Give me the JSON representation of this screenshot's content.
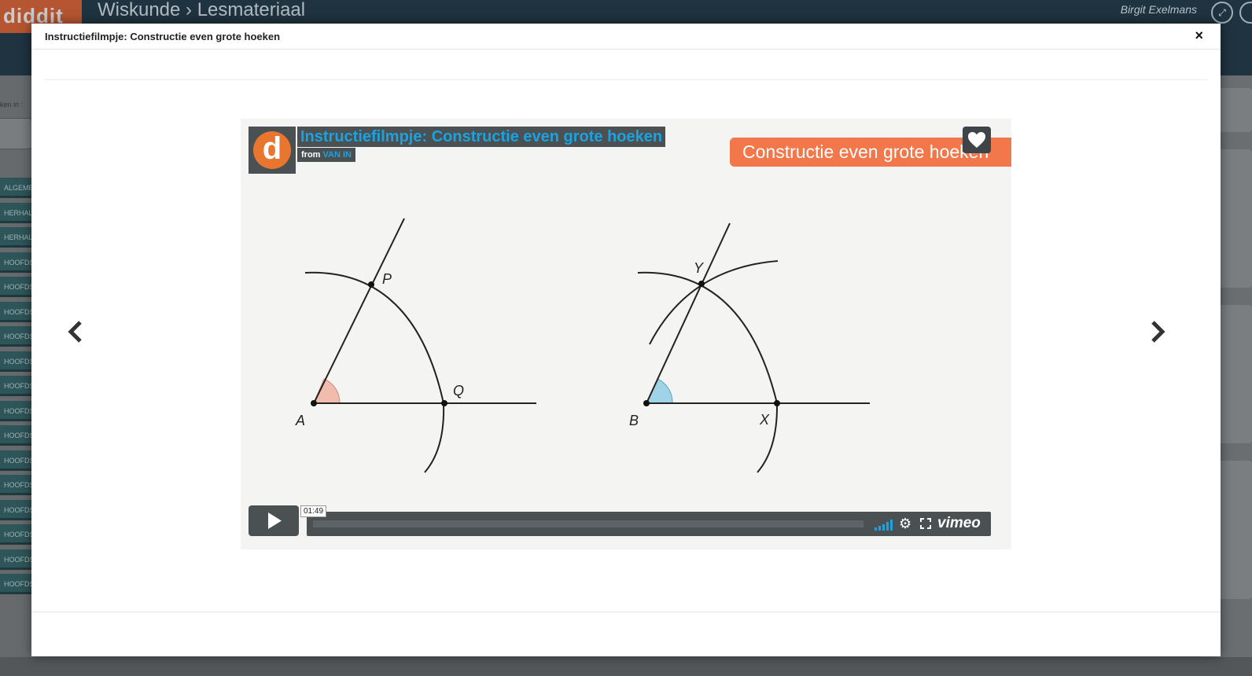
{
  "background": {
    "logo": "diddit",
    "title": "Wiskunde › Lesmateriaal",
    "user": "Birgit Exelmans",
    "search_label": "ken in :",
    "sidebar_items": [
      "ALGEME",
      "HERHAL",
      "HERHAL",
      "HOOFDS",
      "HOOFDS EXPONE",
      "HOOFDS",
      "HOOFDS",
      "HOOFDS",
      "HOOFDS",
      "HOOFDS",
      "HOOFDS",
      "HOOFDS",
      "HOOFDS",
      "HOOFDS",
      "HOOFDS",
      "HOOFDS",
      "HOOFDS"
    ]
  },
  "modal": {
    "title": "Instructiefilmpje: Constructie even grote hoeken",
    "close": "×"
  },
  "video": {
    "logo_letter": "d",
    "title": "Instructiefilmpje: Constructie even grote hoeken",
    "from_label": "from",
    "from_link": "VAN IN",
    "banner": "Constructie even grote hoeken",
    "time": "01:49",
    "brand": "vimeo",
    "labels": {
      "P": "P",
      "Q": "Q",
      "A": "A",
      "Y": "Y",
      "X": "X",
      "B": "B"
    },
    "colors": {
      "accent": "#1aa3e0",
      "banner": "#f2774a",
      "angle_a": "#f0a898",
      "angle_b": "#8ccbe5"
    }
  }
}
